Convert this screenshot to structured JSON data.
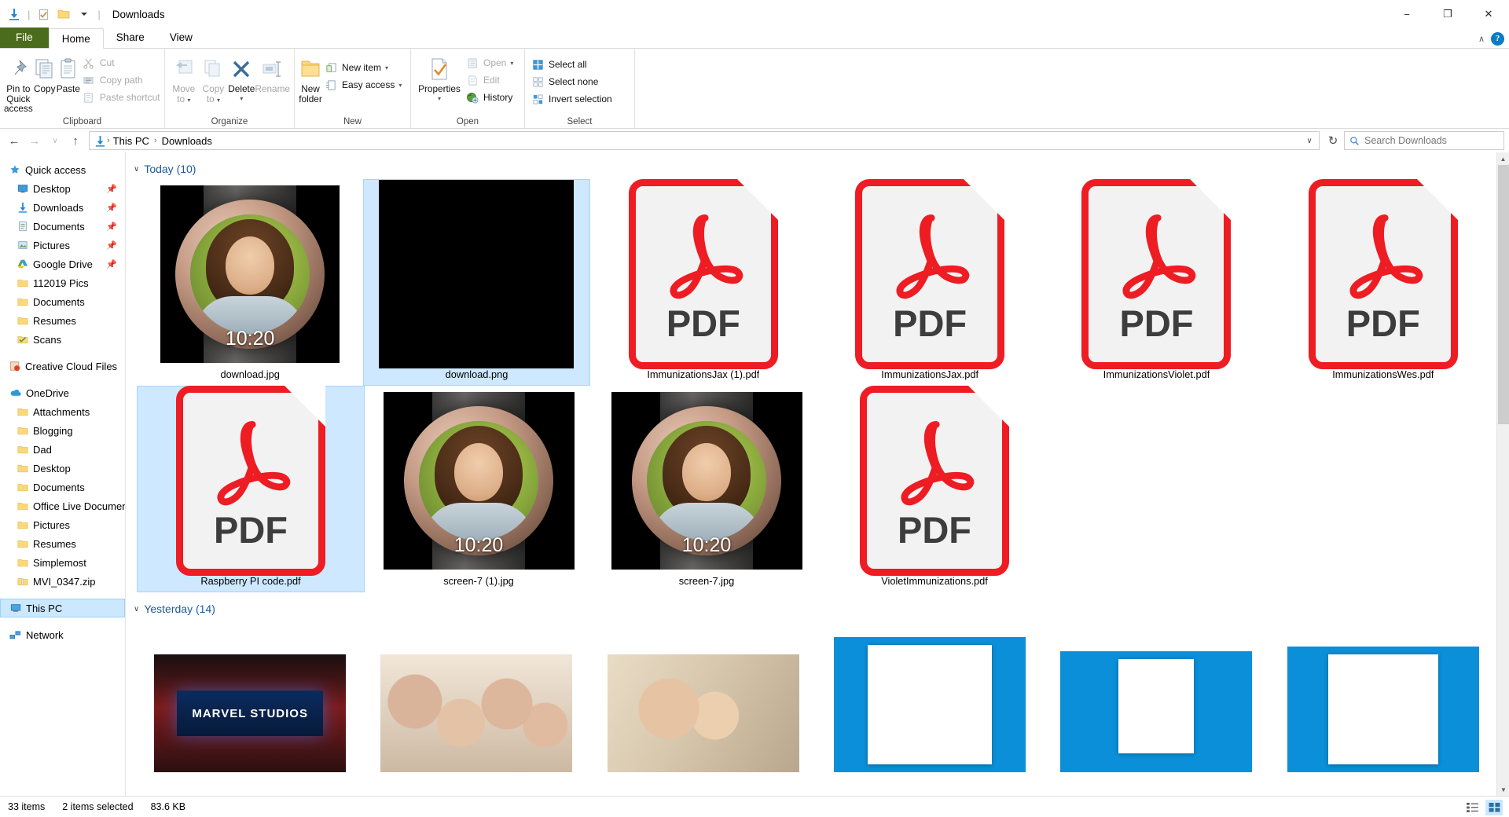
{
  "window": {
    "title": "Downloads",
    "quick_access_icons": [
      "downloads-icon",
      "properties-icon",
      "new-folder-icon",
      "customize-chevron-icon"
    ],
    "controls": {
      "minimize": "−",
      "maximize": "❐",
      "close": "✕"
    }
  },
  "ribbon": {
    "tabs": [
      {
        "label": "File",
        "type": "file"
      },
      {
        "label": "Home",
        "type": "active"
      },
      {
        "label": "Share",
        "type": "normal"
      },
      {
        "label": "View",
        "type": "normal"
      }
    ],
    "help_label": "?",
    "collapse_label": "∧",
    "groups": [
      {
        "name": "Clipboard",
        "big": [
          {
            "label": "Pin to Quick\naccess",
            "label_line1": "Pin to Quick",
            "label_line2": "access",
            "icon": "pin-icon",
            "disabled": false
          },
          {
            "label": "Copy",
            "icon": "copy-icon",
            "disabled": false
          },
          {
            "label": "Paste",
            "icon": "paste-icon",
            "disabled": false
          }
        ],
        "small": [
          {
            "label": "Cut",
            "icon": "scissors-icon",
            "disabled": true
          },
          {
            "label": "Copy path",
            "icon": "copy-path-icon",
            "disabled": true
          },
          {
            "label": "Paste shortcut",
            "icon": "paste-shortcut-icon",
            "disabled": true
          }
        ]
      },
      {
        "name": "Organize",
        "big": [
          {
            "label_line1": "Move",
            "label_line2": "to",
            "icon": "move-to-icon",
            "disabled": true,
            "dropdown": true
          },
          {
            "label_line1": "Copy",
            "label_line2": "to",
            "icon": "copy-to-icon",
            "disabled": true,
            "dropdown": true
          },
          {
            "label": "Delete",
            "icon": "delete-icon",
            "disabled": false,
            "dropdown": true
          },
          {
            "label": "Rename",
            "icon": "rename-icon",
            "disabled": true
          }
        ],
        "small": []
      },
      {
        "name": "New",
        "big": [
          {
            "label_line1": "New",
            "label_line2": "folder",
            "icon": "new-folder-icon",
            "disabled": false
          }
        ],
        "small": [
          {
            "label": "New item",
            "icon": "new-item-icon",
            "disabled": false,
            "dropdown": true
          },
          {
            "label": "Easy access",
            "icon": "easy-access-icon",
            "disabled": false,
            "dropdown": true
          }
        ]
      },
      {
        "name": "Open",
        "big": [
          {
            "label": "Properties",
            "icon": "properties-icon",
            "disabled": false,
            "dropdown": true
          }
        ],
        "small": [
          {
            "label": "Open",
            "icon": "open-icon",
            "disabled": true,
            "dropdown": true
          },
          {
            "label": "Edit",
            "icon": "edit-icon",
            "disabled": true
          },
          {
            "label": "History",
            "icon": "history-icon",
            "disabled": false
          }
        ]
      },
      {
        "name": "Select",
        "big": [],
        "small": [
          {
            "label": "Select all",
            "icon": "select-all-icon",
            "disabled": false
          },
          {
            "label": "Select none",
            "icon": "select-none-icon",
            "disabled": false
          },
          {
            "label": "Invert selection",
            "icon": "invert-selection-icon",
            "disabled": false
          }
        ]
      }
    ]
  },
  "address": {
    "back_icon": "←",
    "forward_icon": "→",
    "recent_icon": "∨",
    "up_icon": "↑",
    "path_icon": "downloads-icon",
    "crumbs": [
      "This PC",
      "Downloads"
    ],
    "separator": "›",
    "dropdown_icon": "∨",
    "refresh_icon": "↻",
    "search_placeholder": "Search Downloads",
    "search_value": "",
    "search_icon": "search-icon"
  },
  "navpane": {
    "items": [
      {
        "label": "Quick access",
        "icon": "star-icon",
        "level": 0,
        "pinned": false,
        "selected": false
      },
      {
        "label": "Desktop",
        "icon": "desktop-icon",
        "level": 1,
        "pinned": true,
        "selected": false
      },
      {
        "label": "Downloads",
        "icon": "downloads-icon",
        "level": 1,
        "pinned": true,
        "selected": false
      },
      {
        "label": "Documents",
        "icon": "documents-icon",
        "level": 1,
        "pinned": true,
        "selected": false
      },
      {
        "label": "Pictures",
        "icon": "pictures-icon",
        "level": 1,
        "pinned": true,
        "selected": false
      },
      {
        "label": "Google Drive",
        "icon": "google-drive-icon",
        "level": 1,
        "pinned": true,
        "selected": false
      },
      {
        "label": "112019 Pics",
        "icon": "folder-icon",
        "level": 1,
        "pinned": false,
        "selected": false
      },
      {
        "label": "Documents",
        "icon": "folder-icon",
        "level": 1,
        "pinned": false,
        "selected": false
      },
      {
        "label": "Resumes",
        "icon": "folder-icon",
        "level": 1,
        "pinned": false,
        "selected": false
      },
      {
        "label": "Scans",
        "icon": "scans-icon",
        "level": 1,
        "pinned": false,
        "selected": false
      },
      {
        "label": "Creative Cloud Files",
        "icon": "creative-cloud-icon",
        "level": 0,
        "pinned": false,
        "selected": false,
        "gap_before": true
      },
      {
        "label": "OneDrive",
        "icon": "onedrive-icon",
        "level": 0,
        "pinned": false,
        "selected": false,
        "gap_before": true
      },
      {
        "label": "Attachments",
        "icon": "folder-icon",
        "level": 1,
        "pinned": false,
        "selected": false
      },
      {
        "label": "Blogging",
        "icon": "folder-icon",
        "level": 1,
        "pinned": false,
        "selected": false
      },
      {
        "label": "Dad",
        "icon": "folder-icon",
        "level": 1,
        "pinned": false,
        "selected": false
      },
      {
        "label": "Desktop",
        "icon": "folder-icon",
        "level": 1,
        "pinned": false,
        "selected": false
      },
      {
        "label": "Documents",
        "icon": "folder-icon",
        "level": 1,
        "pinned": false,
        "selected": false
      },
      {
        "label": "Office Live Documents",
        "icon": "folder-icon",
        "level": 1,
        "pinned": false,
        "selected": false
      },
      {
        "label": "Pictures",
        "icon": "folder-icon",
        "level": 1,
        "pinned": false,
        "selected": false
      },
      {
        "label": "Resumes",
        "icon": "folder-icon",
        "level": 1,
        "pinned": false,
        "selected": false
      },
      {
        "label": "Simplemost",
        "icon": "folder-icon",
        "level": 1,
        "pinned": false,
        "selected": false
      },
      {
        "label": "MVI_0347.zip",
        "icon": "zip-icon",
        "level": 1,
        "pinned": false,
        "selected": false
      },
      {
        "label": "This PC",
        "icon": "this-pc-icon",
        "level": 0,
        "pinned": false,
        "selected": true,
        "gap_before": true
      },
      {
        "label": "Network",
        "icon": "network-icon",
        "level": 0,
        "pinned": false,
        "selected": false,
        "gap_before": true
      }
    ]
  },
  "groups": [
    {
      "header": "Today (10)",
      "collapse_icon": "∨",
      "rows": [
        [
          {
            "name": "download.jpg",
            "thumb": "watch-photo",
            "time": "10:20",
            "selected": false
          },
          {
            "name": "download.png",
            "thumb": "black-image",
            "selected": true
          },
          {
            "name": "ImmunizationsJax (1).pdf",
            "thumb": "pdf",
            "selected": false
          },
          {
            "name": "ImmunizationsJax.pdf",
            "thumb": "pdf",
            "selected": false
          },
          {
            "name": "ImmunizationsViolet.pdf",
            "thumb": "pdf",
            "selected": false
          },
          {
            "name": "ImmunizationsWes.pdf",
            "thumb": "pdf",
            "selected": false
          }
        ],
        [
          {
            "name": "Raspberry PI code.pdf",
            "thumb": "pdf",
            "selected": true
          },
          {
            "name": "screen-7 (1).jpg",
            "thumb": "watch-photo",
            "time": "10:20",
            "selected": false
          },
          {
            "name": "screen-7.jpg",
            "thumb": "watch-photo",
            "time": "10:20",
            "selected": false
          },
          {
            "name": "VioletImmunizations.pdf",
            "thumb": "pdf",
            "selected": false
          }
        ]
      ]
    },
    {
      "header": "Yesterday (14)",
      "collapse_icon": "∨",
      "rows": [
        [
          {
            "name": "",
            "thumb": "marvel-studios",
            "caption": "MARVEL STUDIOS",
            "selected": false
          },
          {
            "name": "",
            "thumb": "family-christmas",
            "selected": false
          },
          {
            "name": "",
            "thumb": "family-kitchen",
            "selected": false
          },
          {
            "name": "",
            "thumb": "blue-window-large",
            "selected": false
          },
          {
            "name": "",
            "thumb": "blue-window-medium",
            "selected": false
          },
          {
            "name": "",
            "thumb": "blue-window-small",
            "selected": false
          }
        ]
      ]
    }
  ],
  "statusbar": {
    "item_count": "33 items",
    "selection": "2 items selected",
    "size": "83.6 KB",
    "view_detail_icon": "details-view-icon",
    "view_thumbnail_icon": "large-icons-view-icon"
  },
  "colors": {
    "accent_blue": "#0078d7",
    "selection_blue": "#cce8ff",
    "pdf_red": "#ee1c23",
    "file_tab_green": "#4b6b1d",
    "group_header_blue": "#1b5a9e"
  }
}
